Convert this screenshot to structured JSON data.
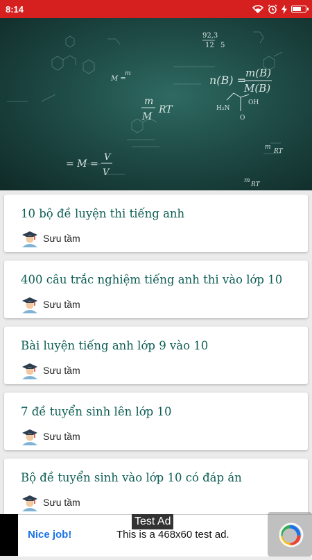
{
  "status_bar": {
    "time": "8:14"
  },
  "hero": {
    "formula_ratio": "92,3",
    "formula_ratio_den": "12",
    "formula_ratio_right": "5",
    "formula_nb": "n(B) =",
    "formula_mb_num": "m(B)",
    "formula_mb_den": "M(B)",
    "formula_m": "m",
    "formula_M": "M",
    "formula_RT": "RT",
    "formula_M_eq": "M =",
    "formula_MeqM": "= M =",
    "formula_V": "V",
    "formula_Vm": "V",
    "formula_h2n": "H₂N",
    "formula_oh": "OH",
    "formula_o": "O",
    "formula_mM": "m",
    "formula_RT2": "RT",
    "formula_mM2": "m",
    "formula_RT3": "RT"
  },
  "items": [
    {
      "title": "10 bộ đề luyện thi tiếng anh",
      "author": "Sưu tầm"
    },
    {
      "title": "400 câu trắc nghiệm tiếng anh thi vào lớp 10",
      "author": "Sưu tầm"
    },
    {
      "title": "Bài luyện tiếng anh lớp 9 vào 10",
      "author": "Sưu tầm"
    },
    {
      "title": "7 đề tuyển sinh lên lớp 10",
      "author": "Sưu tầm"
    },
    {
      "title": "Bộ đề tuyển sinh vào lớp 10 có đáp án",
      "author": "Sưu tầm"
    }
  ],
  "ad": {
    "badge": "Test Ad",
    "cta": "Nice job!",
    "text": "This is a 468x60 test ad."
  },
  "icons": {
    "wifi": "wifi-icon",
    "alarm": "alarm-icon",
    "charging": "charging-icon",
    "battery": "battery-icon",
    "author": "graduate-avatar-icon"
  },
  "colors": {
    "status_bar": "#d61f1f",
    "title_text": "#0d5e55",
    "ad_cta": "#1a73e8"
  },
  "battery_level": 0.7
}
